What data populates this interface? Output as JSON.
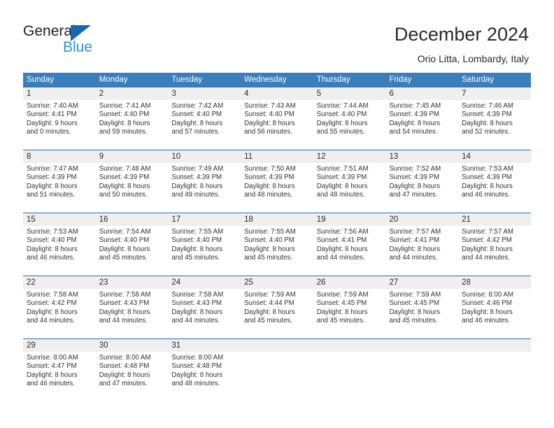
{
  "brand": {
    "name_top": "General",
    "name_bottom": "Blue",
    "accent_color": "#1567b2",
    "accent_light": "#2e8fd8"
  },
  "header": {
    "title": "December 2024",
    "subtitle": "Orio Litta, Lombardy, Italy"
  },
  "calendar": {
    "header_bg": "#3c7ebd",
    "row_divider": "#2e6da4",
    "number_band_bg": "#efefef",
    "weekdays": [
      "Sunday",
      "Monday",
      "Tuesday",
      "Wednesday",
      "Thursday",
      "Friday",
      "Saturday"
    ],
    "weeks": [
      [
        {
          "day": "1",
          "sunrise": "Sunrise: 7:40 AM",
          "sunset": "Sunset: 4:41 PM",
          "daylight_1": "Daylight: 9 hours",
          "daylight_2": "and 0 minutes."
        },
        {
          "day": "2",
          "sunrise": "Sunrise: 7:41 AM",
          "sunset": "Sunset: 4:40 PM",
          "daylight_1": "Daylight: 8 hours",
          "daylight_2": "and 59 minutes."
        },
        {
          "day": "3",
          "sunrise": "Sunrise: 7:42 AM",
          "sunset": "Sunset: 4:40 PM",
          "daylight_1": "Daylight: 8 hours",
          "daylight_2": "and 57 minutes."
        },
        {
          "day": "4",
          "sunrise": "Sunrise: 7:43 AM",
          "sunset": "Sunset: 4:40 PM",
          "daylight_1": "Daylight: 8 hours",
          "daylight_2": "and 56 minutes."
        },
        {
          "day": "5",
          "sunrise": "Sunrise: 7:44 AM",
          "sunset": "Sunset: 4:40 PM",
          "daylight_1": "Daylight: 8 hours",
          "daylight_2": "and 55 minutes."
        },
        {
          "day": "6",
          "sunrise": "Sunrise: 7:45 AM",
          "sunset": "Sunset: 4:39 PM",
          "daylight_1": "Daylight: 8 hours",
          "daylight_2": "and 54 minutes."
        },
        {
          "day": "7",
          "sunrise": "Sunrise: 7:46 AM",
          "sunset": "Sunset: 4:39 PM",
          "daylight_1": "Daylight: 8 hours",
          "daylight_2": "and 52 minutes."
        }
      ],
      [
        {
          "day": "8",
          "sunrise": "Sunrise: 7:47 AM",
          "sunset": "Sunset: 4:39 PM",
          "daylight_1": "Daylight: 8 hours",
          "daylight_2": "and 51 minutes."
        },
        {
          "day": "9",
          "sunrise": "Sunrise: 7:48 AM",
          "sunset": "Sunset: 4:39 PM",
          "daylight_1": "Daylight: 8 hours",
          "daylight_2": "and 50 minutes."
        },
        {
          "day": "10",
          "sunrise": "Sunrise: 7:49 AM",
          "sunset": "Sunset: 4:39 PM",
          "daylight_1": "Daylight: 8 hours",
          "daylight_2": "and 49 minutes."
        },
        {
          "day": "11",
          "sunrise": "Sunrise: 7:50 AM",
          "sunset": "Sunset: 4:39 PM",
          "daylight_1": "Daylight: 8 hours",
          "daylight_2": "and 48 minutes."
        },
        {
          "day": "12",
          "sunrise": "Sunrise: 7:51 AM",
          "sunset": "Sunset: 4:39 PM",
          "daylight_1": "Daylight: 8 hours",
          "daylight_2": "and 48 minutes."
        },
        {
          "day": "13",
          "sunrise": "Sunrise: 7:52 AM",
          "sunset": "Sunset: 4:39 PM",
          "daylight_1": "Daylight: 8 hours",
          "daylight_2": "and 47 minutes."
        },
        {
          "day": "14",
          "sunrise": "Sunrise: 7:53 AM",
          "sunset": "Sunset: 4:39 PM",
          "daylight_1": "Daylight: 8 hours",
          "daylight_2": "and 46 minutes."
        }
      ],
      [
        {
          "day": "15",
          "sunrise": "Sunrise: 7:53 AM",
          "sunset": "Sunset: 4:40 PM",
          "daylight_1": "Daylight: 8 hours",
          "daylight_2": "and 46 minutes."
        },
        {
          "day": "16",
          "sunrise": "Sunrise: 7:54 AM",
          "sunset": "Sunset: 4:40 PM",
          "daylight_1": "Daylight: 8 hours",
          "daylight_2": "and 45 minutes."
        },
        {
          "day": "17",
          "sunrise": "Sunrise: 7:55 AM",
          "sunset": "Sunset: 4:40 PM",
          "daylight_1": "Daylight: 8 hours",
          "daylight_2": "and 45 minutes."
        },
        {
          "day": "18",
          "sunrise": "Sunrise: 7:55 AM",
          "sunset": "Sunset: 4:40 PM",
          "daylight_1": "Daylight: 8 hours",
          "daylight_2": "and 45 minutes."
        },
        {
          "day": "19",
          "sunrise": "Sunrise: 7:56 AM",
          "sunset": "Sunset: 4:41 PM",
          "daylight_1": "Daylight: 8 hours",
          "daylight_2": "and 44 minutes."
        },
        {
          "day": "20",
          "sunrise": "Sunrise: 7:57 AM",
          "sunset": "Sunset: 4:41 PM",
          "daylight_1": "Daylight: 8 hours",
          "daylight_2": "and 44 minutes."
        },
        {
          "day": "21",
          "sunrise": "Sunrise: 7:57 AM",
          "sunset": "Sunset: 4:42 PM",
          "daylight_1": "Daylight: 8 hours",
          "daylight_2": "and 44 minutes."
        }
      ],
      [
        {
          "day": "22",
          "sunrise": "Sunrise: 7:58 AM",
          "sunset": "Sunset: 4:42 PM",
          "daylight_1": "Daylight: 8 hours",
          "daylight_2": "and 44 minutes."
        },
        {
          "day": "23",
          "sunrise": "Sunrise: 7:58 AM",
          "sunset": "Sunset: 4:43 PM",
          "daylight_1": "Daylight: 8 hours",
          "daylight_2": "and 44 minutes."
        },
        {
          "day": "24",
          "sunrise": "Sunrise: 7:58 AM",
          "sunset": "Sunset: 4:43 PM",
          "daylight_1": "Daylight: 8 hours",
          "daylight_2": "and 44 minutes."
        },
        {
          "day": "25",
          "sunrise": "Sunrise: 7:59 AM",
          "sunset": "Sunset: 4:44 PM",
          "daylight_1": "Daylight: 8 hours",
          "daylight_2": "and 45 minutes."
        },
        {
          "day": "26",
          "sunrise": "Sunrise: 7:59 AM",
          "sunset": "Sunset: 4:45 PM",
          "daylight_1": "Daylight: 8 hours",
          "daylight_2": "and 45 minutes."
        },
        {
          "day": "27",
          "sunrise": "Sunrise: 7:59 AM",
          "sunset": "Sunset: 4:45 PM",
          "daylight_1": "Daylight: 8 hours",
          "daylight_2": "and 45 minutes."
        },
        {
          "day": "28",
          "sunrise": "Sunrise: 8:00 AM",
          "sunset": "Sunset: 4:46 PM",
          "daylight_1": "Daylight: 8 hours",
          "daylight_2": "and 46 minutes."
        }
      ],
      [
        {
          "day": "29",
          "sunrise": "Sunrise: 8:00 AM",
          "sunset": "Sunset: 4:47 PM",
          "daylight_1": "Daylight: 8 hours",
          "daylight_2": "and 46 minutes."
        },
        {
          "day": "30",
          "sunrise": "Sunrise: 8:00 AM",
          "sunset": "Sunset: 4:48 PM",
          "daylight_1": "Daylight: 8 hours",
          "daylight_2": "and 47 minutes."
        },
        {
          "day": "31",
          "sunrise": "Sunrise: 8:00 AM",
          "sunset": "Sunset: 4:48 PM",
          "daylight_1": "Daylight: 8 hours",
          "daylight_2": "and 48 minutes."
        },
        {
          "day": "",
          "sunrise": "",
          "sunset": "",
          "daylight_1": "",
          "daylight_2": ""
        },
        {
          "day": "",
          "sunrise": "",
          "sunset": "",
          "daylight_1": "",
          "daylight_2": ""
        },
        {
          "day": "",
          "sunrise": "",
          "sunset": "",
          "daylight_1": "",
          "daylight_2": ""
        },
        {
          "day": "",
          "sunrise": "",
          "sunset": "",
          "daylight_1": "",
          "daylight_2": ""
        }
      ]
    ]
  }
}
